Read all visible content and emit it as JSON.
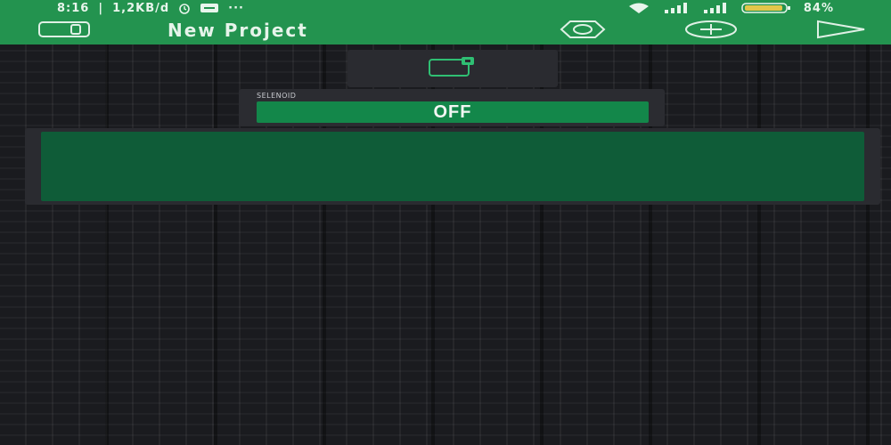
{
  "status_bar": {
    "time": "8:16",
    "data_speed": "1,2KB/d",
    "more": "···",
    "battery_percent": "84%"
  },
  "app_bar": {
    "title": "New Project",
    "icons": [
      "device-manager-icon",
      "settings-hexagon-icon",
      "add-widget-icon",
      "play-icon"
    ]
  },
  "device_tile": {
    "icon": "device-connected-icon"
  },
  "button_widget": {
    "label": "SELENOID",
    "state_text": "OFF"
  },
  "colors": {
    "brand_green": "#23934f",
    "button_green": "#13874a",
    "display_green": "#0f5c38",
    "canvas_bg": "#1a1b1f"
  }
}
